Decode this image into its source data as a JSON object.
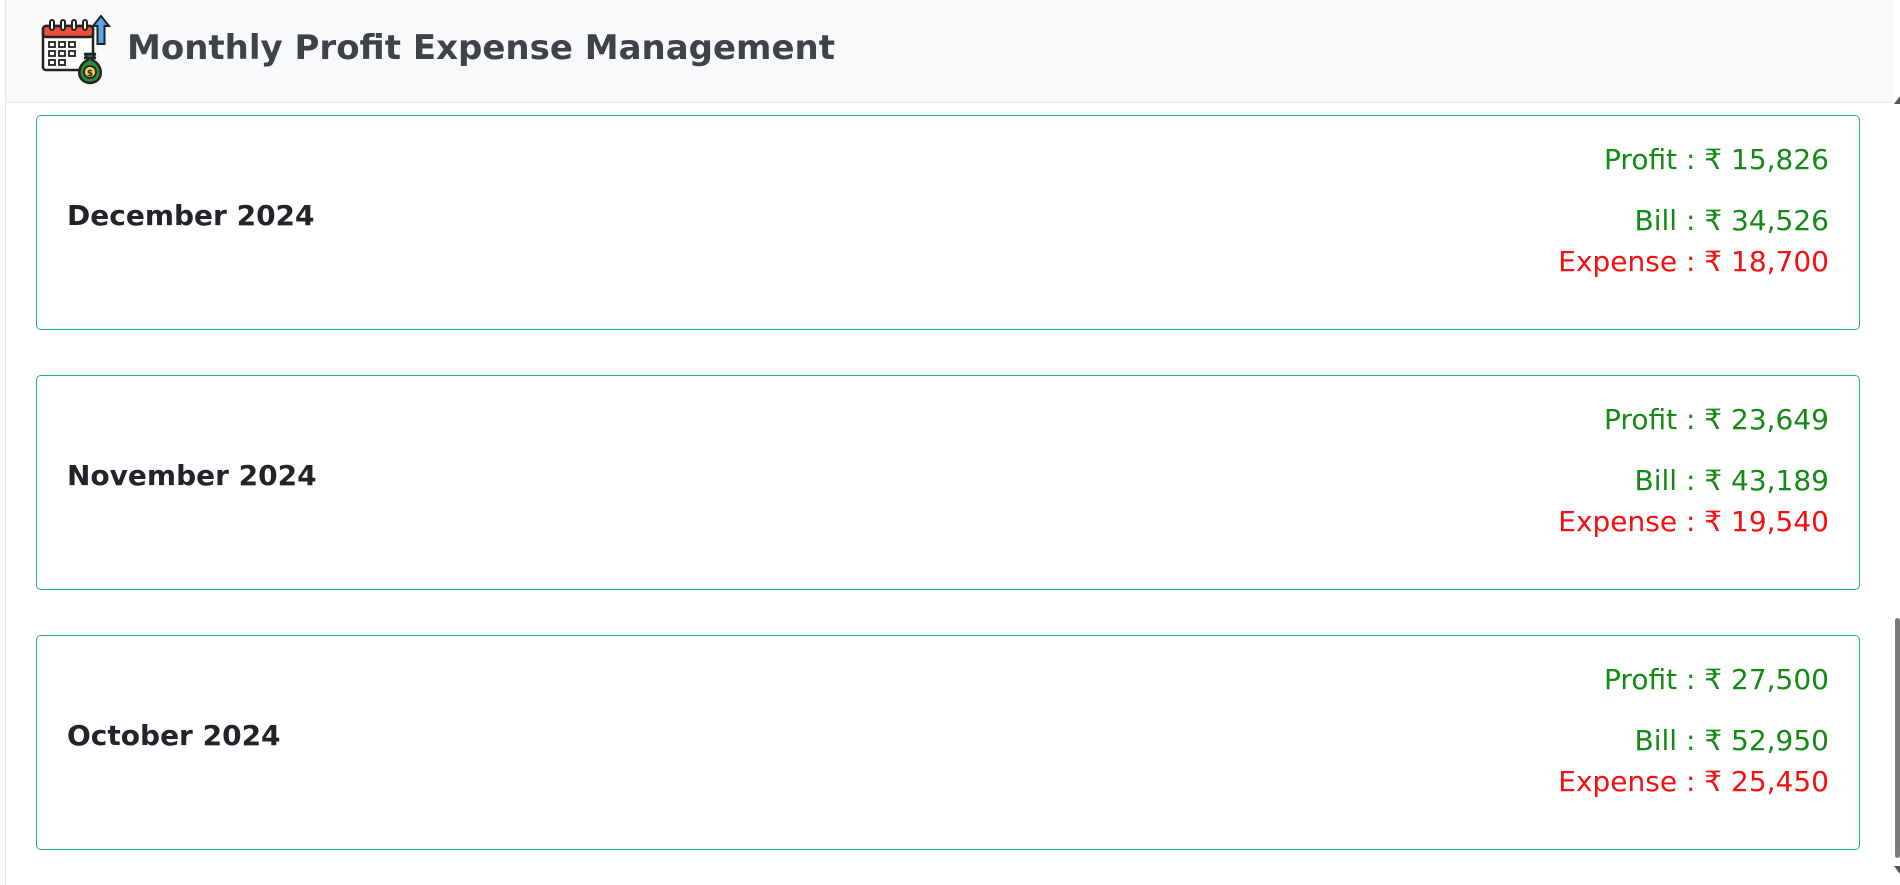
{
  "header": {
    "title": "Monthly Profit Expense Management"
  },
  "months": [
    {
      "label": "December 2024",
      "profit": "Profit : ₹ 15,826",
      "bill": "Bill : ₹ 34,526",
      "expense": "Expense : ₹ 18,700"
    },
    {
      "label": "November 2024",
      "profit": "Profit : ₹ 23,649",
      "bill": "Bill : ₹ 43,189",
      "expense": "Expense : ₹ 19,540"
    },
    {
      "label": "October 2024",
      "profit": "Profit : ₹ 27,500",
      "bill": "Bill : ₹ 52,950",
      "expense": "Expense : ₹ 25,450"
    }
  ],
  "colors": {
    "profit": "#138a13",
    "bill": "#138a13",
    "expense": "#f50f0f",
    "card_border": "#20b28a"
  }
}
